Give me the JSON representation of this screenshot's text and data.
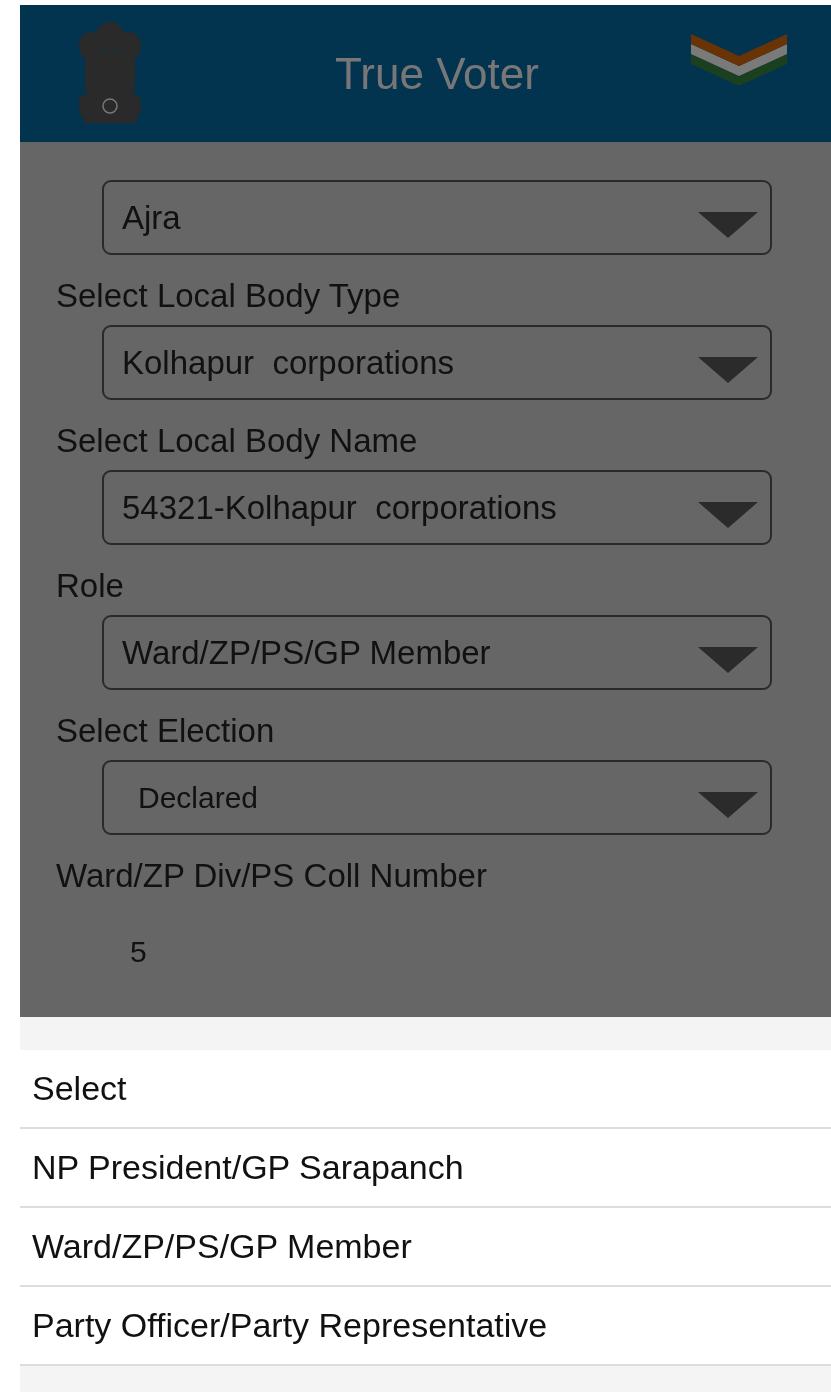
{
  "header": {
    "title": "True Voter"
  },
  "form": [
    {
      "kind": "dropdown",
      "value": "Ajra",
      "small": false
    },
    {
      "kind": "dropdown",
      "label": "Select Local Body Type",
      "value": "Kolhapur  corporations",
      "small": false
    },
    {
      "kind": "dropdown",
      "label": "Select Local Body Name",
      "value": "54321-Kolhapur  corporations",
      "small": false
    },
    {
      "kind": "dropdown",
      "label": "Role",
      "value": "Ward/ZP/PS/GP Member",
      "small": false
    },
    {
      "kind": "dropdown",
      "label": "Select Election",
      "value": "Declared",
      "small": true
    },
    {
      "kind": "text",
      "label": "Ward/ZP Div/PS Coll Number",
      "value": "5"
    }
  ],
  "options": [
    "Select",
    "NP President/GP Sarapanch",
    "Ward/ZP/PS/GP Member",
    "Party Officer/Party Representative"
  ]
}
